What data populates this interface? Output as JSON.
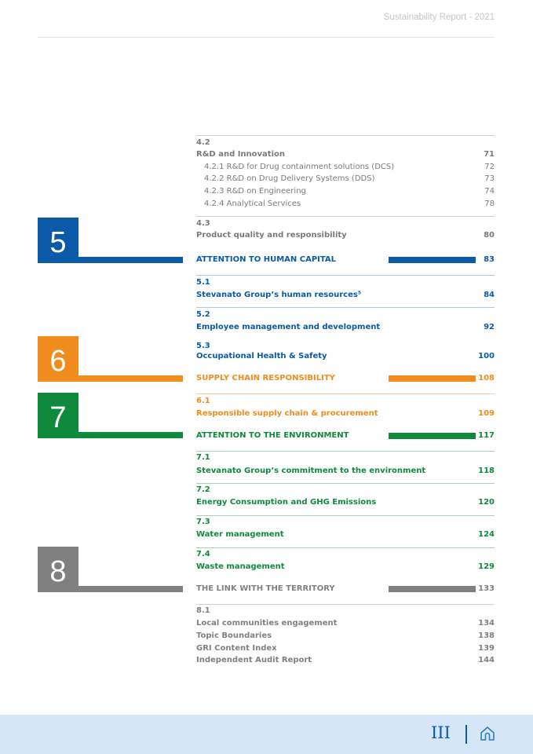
{
  "header": {
    "title": "Sustainability Report - 2021"
  },
  "colors": {
    "blue": "#0a5aa8",
    "orange": "#f08c1e",
    "green": "#0f8a3c",
    "gray": "#808080"
  },
  "toc": {
    "s42": {
      "num": "4.2",
      "title": "R&D and Innovation",
      "page": "71",
      "subs": [
        {
          "title": "4.2.1 R&D for Drug containment solutions (DCS)",
          "page": "72"
        },
        {
          "title": "4.2.2 R&D on Drug Delivery Systems (DDS)",
          "page": "73"
        },
        {
          "title": "4.2.3 R&D on Engineering",
          "page": "74"
        },
        {
          "title": "4.2.4 Analytical Services",
          "page": "78"
        }
      ]
    },
    "s43": {
      "num": "4.3",
      "title": "Product quality and responsibility",
      "page": "80"
    },
    "ch5": {
      "num": "5",
      "title": "ATTENTION TO HUMAN CAPITAL",
      "page": "83"
    },
    "s51": {
      "num": "5.1",
      "title": "Stevanato Group’s human resources⁵",
      "page": "84"
    },
    "s52": {
      "num": "5.2",
      "title": "Employee management and development",
      "page": "92"
    },
    "s53": {
      "num": "5.3",
      "title": "Occupational Health & Safety",
      "page": "100"
    },
    "ch6": {
      "num": "6",
      "title": "SUPPLY CHAIN RESPONSIBILITY",
      "page": "108"
    },
    "s61": {
      "num": "6.1",
      "title": "Responsible supply chain & procurement",
      "page": "109"
    },
    "ch7": {
      "num": "7",
      "title": "ATTENTION TO THE ENVIRONMENT",
      "page": "117"
    },
    "s71": {
      "num": "7.1",
      "title": "Stevanato Group’s commitment to the environment",
      "page": "118"
    },
    "s72": {
      "num": "7.2",
      "title": "Energy Consumption and GHG Emissions",
      "page": "120"
    },
    "s73": {
      "num": "7.3",
      "title": "Water management",
      "page": "124"
    },
    "s74": {
      "num": "7.4",
      "title": "Waste management",
      "page": "129"
    },
    "ch8": {
      "num": "8",
      "title": "THE LINK WITH THE TERRITORY",
      "page": "133"
    },
    "s81": {
      "num": "8.1",
      "items": [
        {
          "title": "Local communities engagement",
          "page": "134"
        },
        {
          "title": "Topic Boundaries",
          "page": "138"
        },
        {
          "title": "GRI Content Index",
          "page": "139"
        },
        {
          "title": "Independent Audit Report",
          "page": "144"
        }
      ]
    }
  },
  "footer": {
    "page_number": "III",
    "home_icon": "home-icon"
  }
}
